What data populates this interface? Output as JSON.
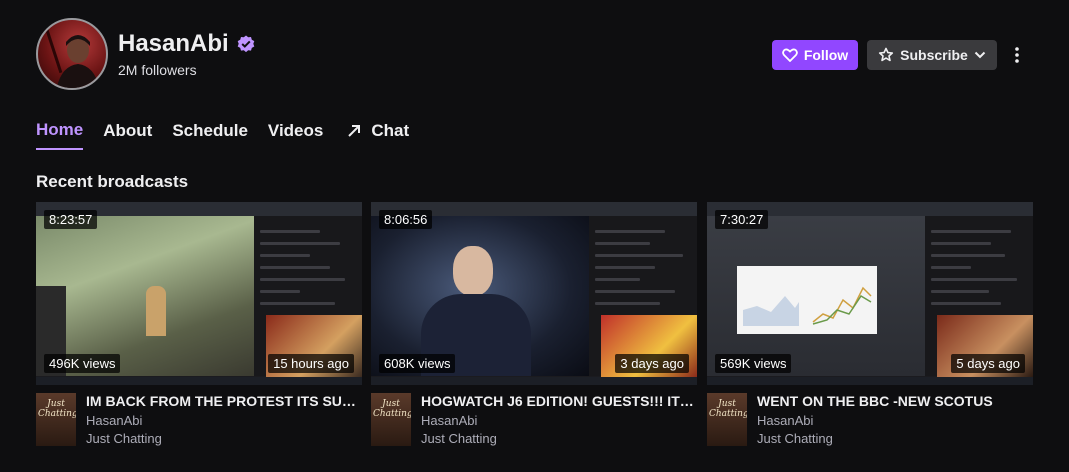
{
  "channel": {
    "name": "HasanAbi",
    "followers": "2M followers"
  },
  "actions": {
    "follow_label": "Follow",
    "subscribe_label": "Subscribe"
  },
  "tabs": [
    {
      "label": "Home",
      "active": true
    },
    {
      "label": "About"
    },
    {
      "label": "Schedule"
    },
    {
      "label": "Videos"
    },
    {
      "label": "Chat"
    }
  ],
  "section": {
    "title": "Recent broadcasts"
  },
  "videos": [
    {
      "duration": "8:23:57",
      "views": "496K views",
      "ago": "15 hours ago",
      "title": "IM BACK FROM THE PROTEST ITS SUN…",
      "channel": "HasanAbi",
      "category": "Just Chatting"
    },
    {
      "duration": "8:06:56",
      "views": "608K views",
      "ago": "3 days ago",
      "title": "HOGWATCH J6 EDITION! GUESTS!!! IT…",
      "channel": "HasanAbi",
      "category": "Just Chatting"
    },
    {
      "duration": "7:30:27",
      "views": "569K views",
      "ago": "5 days ago",
      "title": "WENT ON THE BBC -NEW SCOTUS",
      "channel": "HasanAbi",
      "category": "Just Chatting"
    }
  ],
  "game_box_art_text": "Just Chatting",
  "colors": {
    "background": "#0e0e10",
    "accent": "#9147ff",
    "accent_light": "#bf94ff",
    "subscribe_bg": "#3a3a3d"
  }
}
